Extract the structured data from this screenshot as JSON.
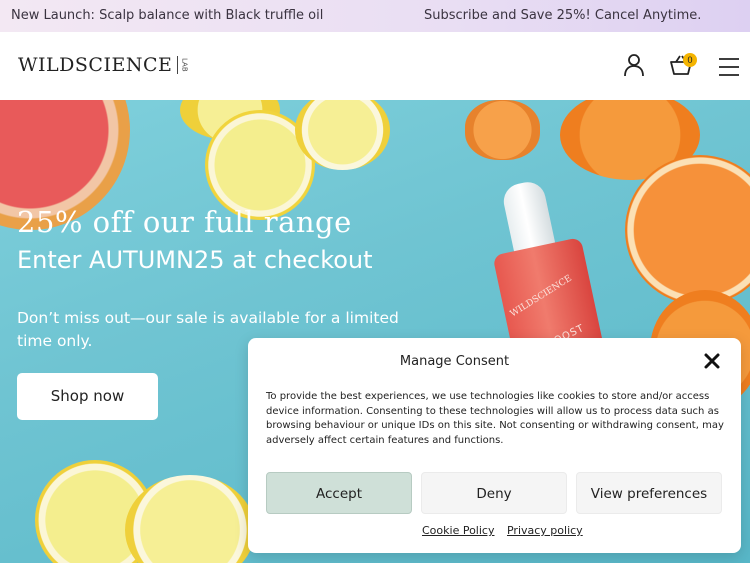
{
  "announcement": {
    "left": "New Launch: Scalp balance with Black truffle oil",
    "right": "Subscribe and Save 25%! Cancel Anytime."
  },
  "header": {
    "logo_text": "WILDSCIENCE",
    "logo_sub": "LAB",
    "cart_count": "0",
    "icons": [
      "user-icon",
      "cart-icon",
      "menu-icon"
    ]
  },
  "hero": {
    "title": "25% off our full range",
    "subtitle": "Enter AUTUMN25 at checkout",
    "text": "Don’t miss out—our sale is available for a limited time only.",
    "cta": "Shop now",
    "bottle_brand": "WILDSCIENCE",
    "bottle_product": "JUICE BOOST"
  },
  "consent": {
    "title": "Manage Consent",
    "body": "To provide the best experiences, we use technologies like cookies to store and/or access device information. Consenting to these technologies will allow us to process data such as browsing behaviour or unique IDs on this site. Not consenting or withdrawing consent, may adversely affect certain features and functions.",
    "accept": "Accept",
    "deny": "Deny",
    "preferences": "View preferences",
    "cookie_policy": "Cookie Policy",
    "privacy_policy": "Privacy policy"
  },
  "colors": {
    "hero_bg": "#6fc4d2",
    "accept_bg": "#cfe0d8",
    "badge": "#f4b400"
  }
}
